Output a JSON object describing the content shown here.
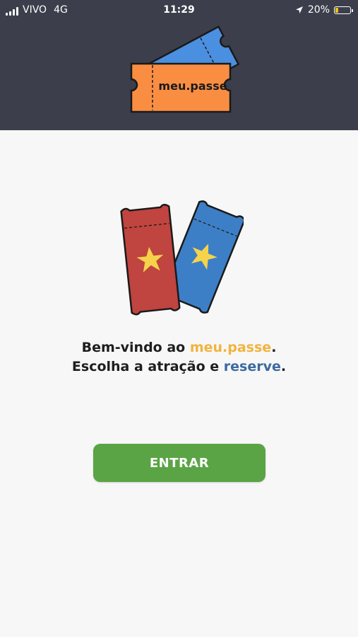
{
  "status_bar": {
    "carrier": "VIVO",
    "network": "4G",
    "time": "11:29",
    "battery": "20%",
    "battery_level": 0.2,
    "location_icon": "location-arrow-icon"
  },
  "logo": {
    "text": "meu.passe",
    "colors": {
      "front_ticket": "#f98e43",
      "back_ticket": "#4b8fe0"
    }
  },
  "hero": {
    "icon": "tickets-icon",
    "colors": {
      "red_ticket": "#c0443f",
      "blue_ticket": "#3c7fc6",
      "star": "#f5d34a"
    }
  },
  "welcome": {
    "line1_prefix": "Bem-vindo ao ",
    "line1_brand": "meu.passe",
    "line1_suffix": ".",
    "line2_prefix": "Escolha a atração e ",
    "line2_highlight": "reserve",
    "line2_suffix": "."
  },
  "actions": {
    "enter_label": "ENTRAR"
  },
  "colors": {
    "header_bg": "#3c3f4b",
    "page_bg": "#f7f7f7",
    "brand_yellow": "#f2b33d",
    "brand_blue": "#3b6aa0",
    "button_green": "#5aa445"
  }
}
